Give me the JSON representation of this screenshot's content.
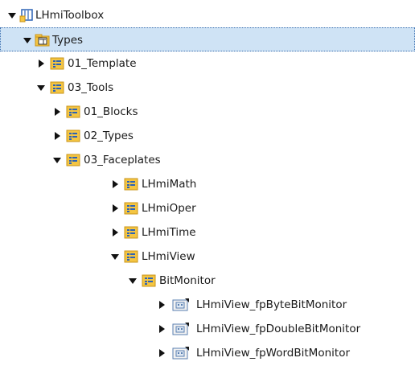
{
  "tree": {
    "root": {
      "label": "LHmiToolbox",
      "icon": "library-icon",
      "state": "expanded"
    },
    "types": {
      "label": "Types",
      "icon": "types-folder-icon",
      "state": "expanded",
      "selected": true
    },
    "template": {
      "label": "01_Template",
      "icon": "folder-icon",
      "state": "collapsed"
    },
    "tools": {
      "label": "03_Tools",
      "icon": "folder-icon",
      "state": "expanded"
    },
    "blocks": {
      "label": "01_Blocks",
      "icon": "folder-icon",
      "state": "collapsed"
    },
    "types2": {
      "label": "02_Types",
      "icon": "folder-icon",
      "state": "collapsed"
    },
    "faceplates": {
      "label": "03_Faceplates",
      "icon": "folder-icon",
      "state": "expanded"
    },
    "math": {
      "label": "LHmiMath",
      "icon": "folder-icon",
      "state": "collapsed"
    },
    "oper": {
      "label": "LHmiOper",
      "icon": "folder-icon",
      "state": "collapsed"
    },
    "time": {
      "label": "LHmiTime",
      "icon": "folder-icon",
      "state": "collapsed"
    },
    "view": {
      "label": "LHmiView",
      "icon": "folder-icon",
      "state": "expanded"
    },
    "bitmonitor": {
      "label": "BitMonitor",
      "icon": "folder-icon",
      "state": "expanded"
    },
    "byte": {
      "label": "LHmiView_fpByteBitMonitor",
      "icon": "faceplate-type-icon",
      "state": "collapsed"
    },
    "double": {
      "label": "LHmiView_fpDoubleBitMonitor",
      "icon": "faceplate-type-icon",
      "state": "collapsed"
    },
    "word": {
      "label": "LHmiView_fpWordBitMonitor",
      "icon": "faceplate-type-icon",
      "state": "collapsed"
    }
  },
  "colors": {
    "selection_bg": "#cfe3f5",
    "selection_border": "#3a6fb0",
    "folder_yellow": "#f4c542",
    "folder_border": "#c9941a"
  }
}
